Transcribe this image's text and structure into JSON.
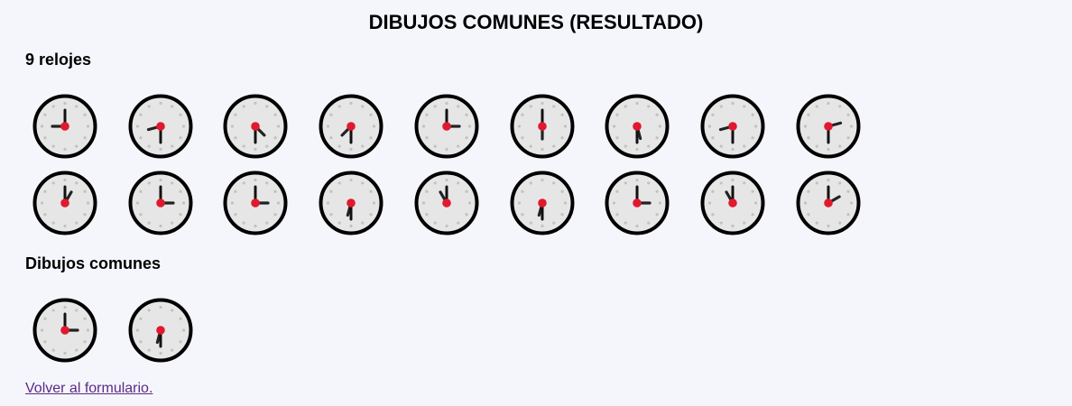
{
  "page": {
    "title": "DIBUJOS COMUNES (RESULTADO)",
    "clocks_heading": "9 relojes",
    "common_heading": "Dibujos comunes",
    "back_link": "Volver al formulario."
  },
  "colors": {
    "background": "#f5f6fb",
    "clock_face": "#e6e6e6",
    "clock_rim": "#000000",
    "hand": "#222222",
    "center_dot": "#e0192e",
    "marker_dot": "#c2c2c2",
    "link": "#5b2a86"
  },
  "clock_rows": [
    [
      {
        "hour": 9,
        "minute": 0
      },
      {
        "hour": 8,
        "minute": 30
      },
      {
        "hour": 4,
        "minute": 30
      },
      {
        "hour": 7,
        "minute": 30
      },
      {
        "hour": 3,
        "minute": 0
      },
      {
        "hour": 6,
        "minute": 0
      },
      {
        "hour": 5,
        "minute": 30
      },
      {
        "hour": 8,
        "minute": 30
      },
      {
        "hour": 2,
        "minute": 30
      }
    ],
    [
      {
        "hour": 1,
        "minute": 0
      },
      {
        "hour": 3,
        "minute": 0
      },
      {
        "hour": 3,
        "minute": 0
      },
      {
        "hour": 6,
        "minute": 30
      },
      {
        "hour": 11,
        "minute": 0
      },
      {
        "hour": 6,
        "minute": 30
      },
      {
        "hour": 3,
        "minute": 0
      },
      {
        "hour": 11,
        "minute": 0
      },
      {
        "hour": 2,
        "minute": 0
      }
    ]
  ],
  "common_clocks": [
    {
      "hour": 3,
      "minute": 0
    },
    {
      "hour": 6,
      "minute": 30
    }
  ]
}
